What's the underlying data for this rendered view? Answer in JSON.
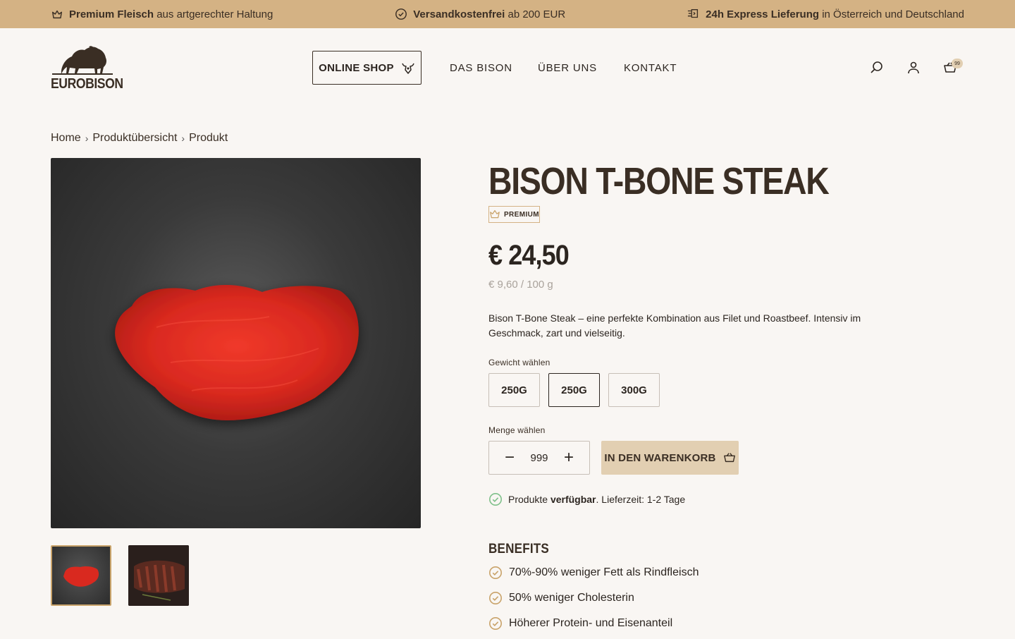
{
  "topbar": {
    "item1_bold": "Premium Fleisch",
    "item1_rest": " aus artgerechter Haltung",
    "item2_bold": "Versandkostenfrei",
    "item2_rest": " ab 200 EUR",
    "item3_bold": "24h Express Lieferung",
    "item3_rest": " in Österreich und Deutschland"
  },
  "header": {
    "logo_text": "EUROBISON",
    "online_shop": "ONLINE SHOP",
    "nav": [
      "DAS BISON",
      "ÜBER UNS",
      "KONTAKT"
    ],
    "cart_count": "99"
  },
  "breadcrumb": [
    "Home",
    "Produktübersicht",
    "Produkt"
  ],
  "product": {
    "title": "BISON T-BONE STEAK",
    "badge": "PREMIUM",
    "price": "€ 24,50",
    "unit_price": "€ 9,60 / 100 g",
    "description": "Bison T-Bone Steak – eine perfekte Kombination aus Filet und Roastbeef. Intensiv im Geschmack, zart und vielseitig.",
    "weight_label": "Gewicht wählen",
    "weights": [
      "250G",
      "250G",
      "300G"
    ],
    "selected_weight_index": 1,
    "quantity_label": "Menge wählen",
    "quantity": "999",
    "add_to_cart": "IN DEN WARENKORB",
    "availability_prefix": "Produkte ",
    "availability_bold": "verfügbar",
    "availability_suffix": ". Lieferzeit: 1-2 Tage",
    "benefits_title": "BENEFITS",
    "benefits": [
      "70%-90% weniger Fett als Rindfleisch",
      "50% weniger Cholesterin",
      "Höherer Protein- und Eisenanteil"
    ]
  },
  "colors": {
    "topbar_bg": "#d4b284",
    "page_bg": "#f9f6f3",
    "accent": "#e2cfb2",
    "text": "#2c2520",
    "success": "#7fc08a",
    "gold": "#c9a36a"
  }
}
